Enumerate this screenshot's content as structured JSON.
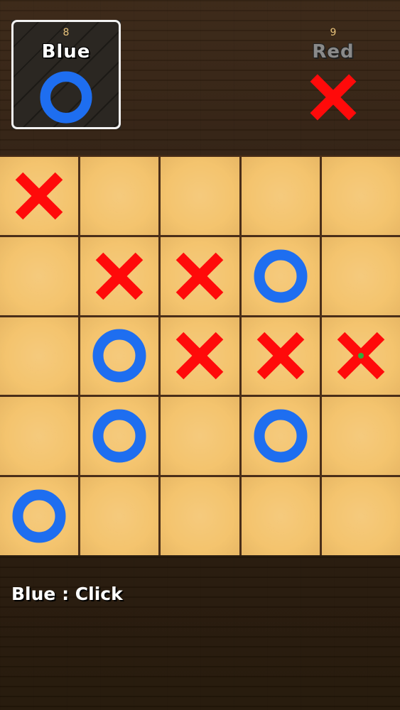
{
  "players": [
    {
      "name": "Blue",
      "score": "8",
      "symbol": "O",
      "active": true,
      "color": "#1e6ef0"
    },
    {
      "name": "Red",
      "score": "9",
      "symbol": "X",
      "active": false,
      "color": "#ff0a0a"
    }
  ],
  "board": {
    "size": 5,
    "cells": [
      [
        "X",
        "",
        "",
        "",
        ""
      ],
      [
        "",
        "X",
        "X",
        "O",
        ""
      ],
      [
        "",
        "O",
        "X",
        "X",
        "X"
      ],
      [
        "",
        "O",
        "",
        "O",
        ""
      ],
      [
        "O",
        "",
        "",
        "",
        ""
      ]
    ],
    "cursor": {
      "row": 2,
      "col": 4
    }
  },
  "status": {
    "text": "Blue : Click"
  },
  "colors": {
    "x_mark": "#ff0a0a",
    "o_mark": "#1e6ef0",
    "cell": "#f4c46e",
    "grid_line": "#4a2e18"
  }
}
